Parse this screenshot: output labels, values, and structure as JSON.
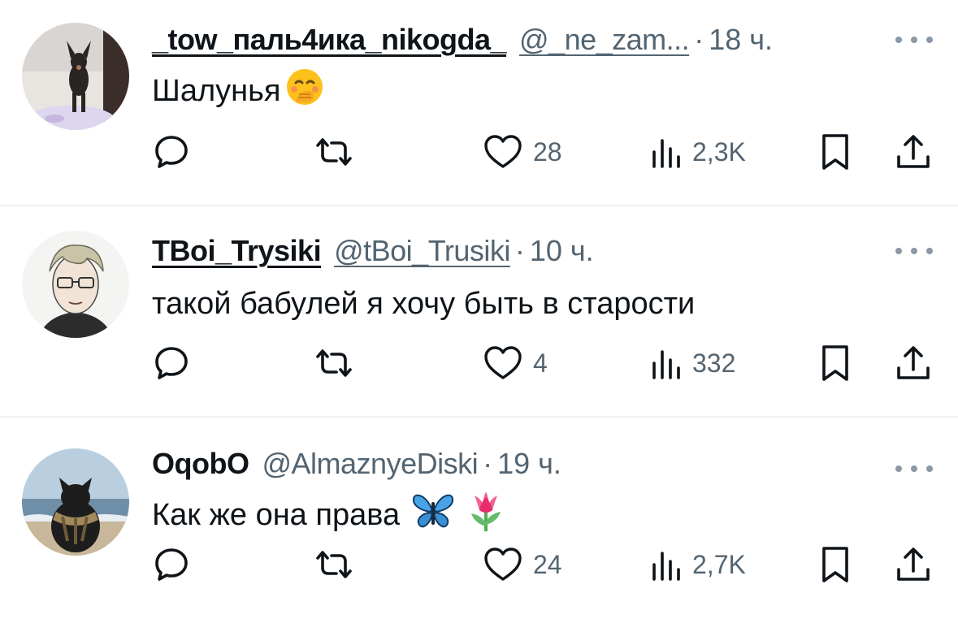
{
  "tweets": [
    {
      "name": "_tow_паль4ика_nikogda_",
      "handle": "@_ne_zam...",
      "time": "18 ч.",
      "text": "Шалунья",
      "emojis": [
        "face-with-hand-over-mouth"
      ],
      "avatar": "dog-avatar",
      "replies": "",
      "retweets": "",
      "likes": "28",
      "views": "2,3K"
    },
    {
      "name": "TBoi_Trysiki",
      "handle": "@tBoi_Trusiki",
      "time": "10 ч.",
      "text": "такой бабулей я хочу быть в старости",
      "emojis": [],
      "avatar": "anime-man-glasses-avatar",
      "replies": "",
      "retweets": "",
      "likes": "4",
      "views": "332"
    },
    {
      "name": "OqobO",
      "handle": "@AlmaznyeDiski",
      "time": "19 ч.",
      "text": "Как же она права",
      "emojis": [
        "butterfly",
        "tulip"
      ],
      "avatar": "cat-at-sea-avatar",
      "replies": "",
      "retweets": "",
      "likes": "24",
      "views": "2,7K"
    }
  ],
  "separator": "·",
  "colors": {
    "text": "#0f1419",
    "secondary": "#536471",
    "divider": "#eff3f4"
  }
}
